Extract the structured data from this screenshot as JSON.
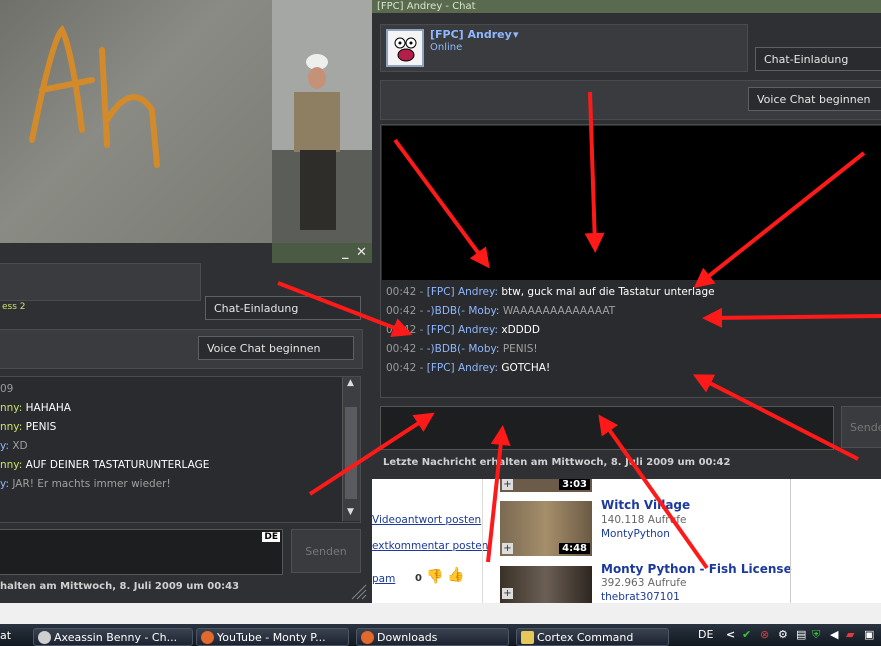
{
  "left_window": {
    "partial_game": "ess 2",
    "chat_invite": "Chat-Einladung",
    "voice_chat": "Voice Chat beginnen",
    "log_partial_first": "09",
    "lines": [
      {
        "name": "nny:",
        "message": "HAHAHA",
        "style": "white"
      },
      {
        "name": "nny:",
        "message": "PENIS",
        "style": "white"
      },
      {
        "name": "y:",
        "message": "XD",
        "style": "grey"
      },
      {
        "name": "nny:",
        "message": "AUF DEINER TASTATURUNTERLAGE",
        "style": "white"
      },
      {
        "name": "y:",
        "message": "JAR! Er machts immer wieder!",
        "style": "grey"
      }
    ],
    "lang_badge": "DE",
    "send": "Senden",
    "status": "halten am Mittwoch, 8. Juli 2009 um 00:43"
  },
  "right_window": {
    "title": "[FPC] Andrey - Chat",
    "username": "[FPC] Andrey",
    "dropdown": "▾",
    "status_online": "Online",
    "chat_invite": "Chat-Einladung",
    "voice_chat": "Voice Chat beginnen",
    "lines": [
      {
        "time": "00:42 -",
        "name": "[FPC] Andrey:",
        "message": "btw, guck mal auf die Tastatur unterlage",
        "style": "white"
      },
      {
        "time": "00:42 -",
        "name": "-)BDB(- Moby:",
        "message": "WAAAAAAAAAAAAAT",
        "style": "grey"
      },
      {
        "time": "00:42 -",
        "name": "[FPC] Andrey:",
        "message": "xDDDD",
        "style": "white"
      },
      {
        "time": "00:42 -",
        "name": "-)BDB(- Moby:",
        "message": "PENIS!",
        "style": "grey"
      },
      {
        "time": "00:42 -",
        "name": "[FPC] Andrey:",
        "message": "GOTCHA!",
        "style": "white"
      }
    ],
    "send": "Sende",
    "status": "Letzte Nachricht erhalten am Mittwoch, 8. Juli 2009 um 00:42"
  },
  "youtube": {
    "link_video_reply": "Videoantwort posten",
    "link_text_comment": "extkommentar posten",
    "link_spam": "pam",
    "rating_count": "0",
    "dur_top": "3:03",
    "videos": [
      {
        "title": "Witch Village",
        "views": "140.118 Aufrufe",
        "user": "MontyPython",
        "duration": "4:48"
      },
      {
        "title": "Monty Python - Fish License",
        "views": "392.963 Aufrufe",
        "user": "thebrat307101",
        "duration": ""
      }
    ]
  },
  "taskbar": {
    "start_partial": "at",
    "tasks": [
      "Axeassin Benny - Ch...",
      "YouTube - Monty P...",
      "Downloads",
      "Cortex Command"
    ],
    "lang": "DE",
    "tray_chevron": "<"
  }
}
